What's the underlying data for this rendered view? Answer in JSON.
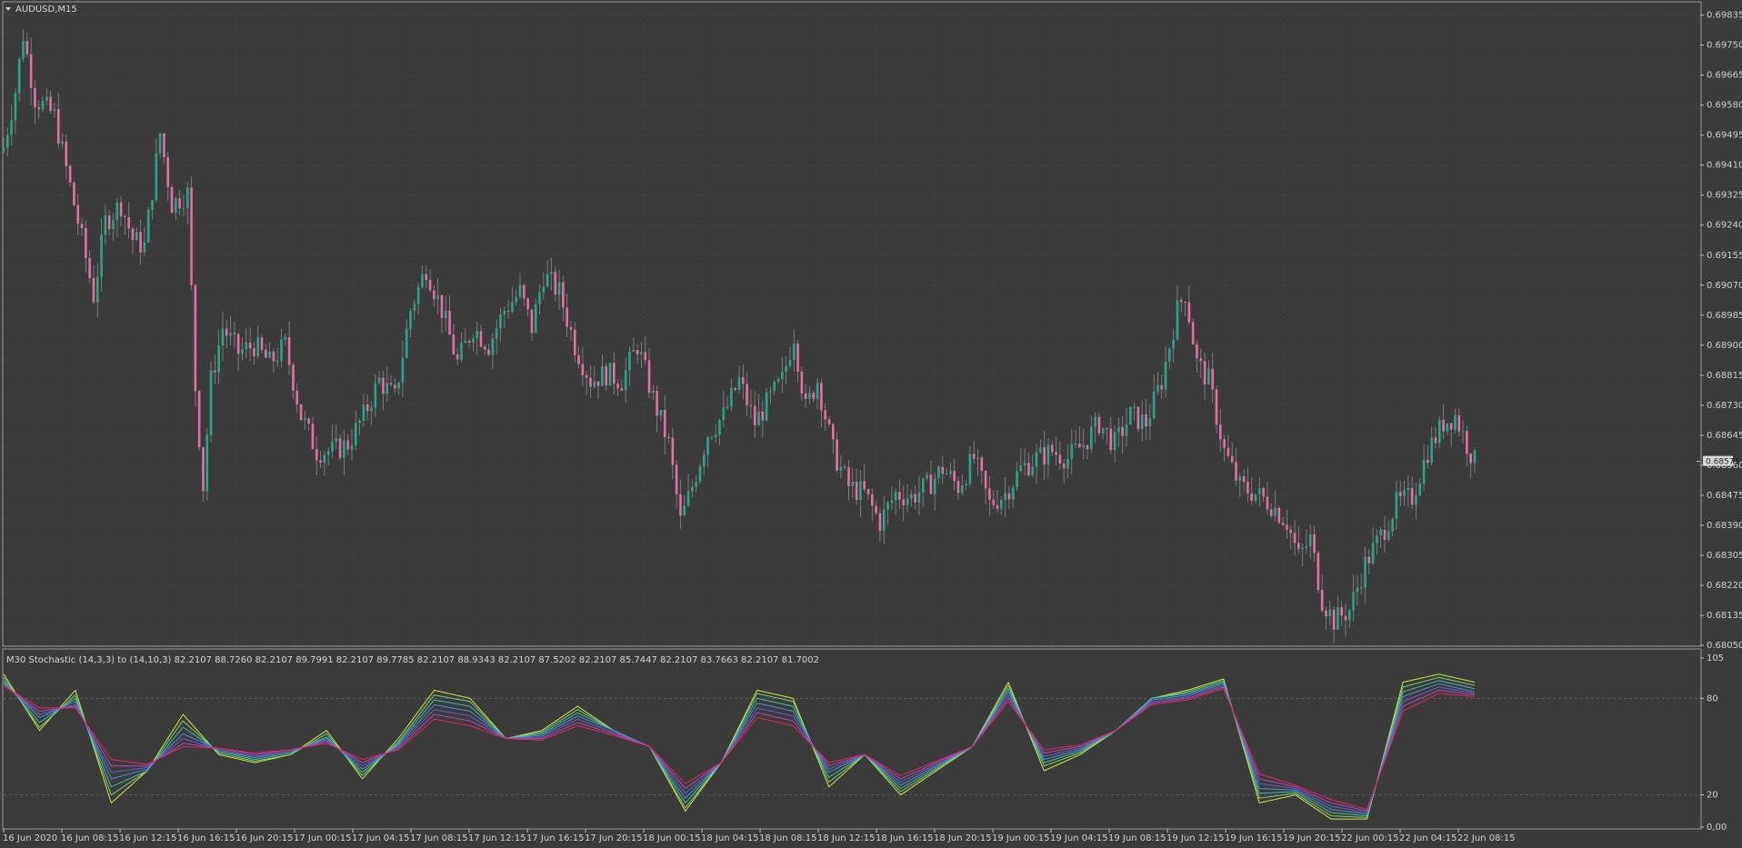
{
  "window": {
    "symbol_label": "AUDUSD,M15",
    "menu_icon": "triangle-down-icon"
  },
  "colors": {
    "background": "#3b3b3b",
    "grid": "#4a4a4a",
    "border": "#9a9a9a",
    "bull": "#26a98a",
    "bear": "#e86fa4",
    "text": "#d0d0d0"
  },
  "chart_data": [
    {
      "type": "candlestick",
      "title": "AUDUSD,M15",
      "ylim": [
        0.6805,
        0.6987
      ],
      "y_ticks": [
        "0.69835",
        "0.69750",
        "0.69665",
        "0.69580",
        "0.69495",
        "0.69410",
        "0.69325",
        "0.69240",
        "0.69155",
        "0.69070",
        "0.68985",
        "0.68900",
        "0.68815",
        "0.68730",
        "0.68645",
        "0.68560",
        "0.68475",
        "0.68390",
        "0.68305",
        "0.68220",
        "0.68135",
        "0.68050"
      ],
      "current_price_label": "0.68571",
      "current_price": 0.68571,
      "close_points": [
        {
          "t": 0,
          "v": 0.6946
        },
        {
          "t": 3,
          "v": 0.6962
        },
        {
          "t": 5,
          "v": 0.6978
        },
        {
          "t": 8,
          "v": 0.696
        },
        {
          "t": 13,
          "v": 0.6955
        },
        {
          "t": 17,
          "v": 0.6935
        },
        {
          "t": 20,
          "v": 0.692
        },
        {
          "t": 23,
          "v": 0.6904
        },
        {
          "t": 26,
          "v": 0.6925
        },
        {
          "t": 30,
          "v": 0.693
        },
        {
          "t": 33,
          "v": 0.692
        },
        {
          "t": 36,
          "v": 0.6918
        },
        {
          "t": 40,
          "v": 0.695
        },
        {
          "t": 43,
          "v": 0.693
        },
        {
          "t": 47,
          "v": 0.6933
        },
        {
          "t": 49,
          "v": 0.6878
        },
        {
          "t": 51,
          "v": 0.685
        },
        {
          "t": 53,
          "v": 0.688
        },
        {
          "t": 56,
          "v": 0.6895
        },
        {
          "t": 60,
          "v": 0.6888
        },
        {
          "t": 64,
          "v": 0.689
        },
        {
          "t": 68,
          "v": 0.6885
        },
        {
          "t": 72,
          "v": 0.689
        },
        {
          "t": 76,
          "v": 0.687
        },
        {
          "t": 80,
          "v": 0.686
        },
        {
          "t": 84,
          "v": 0.686
        },
        {
          "t": 88,
          "v": 0.6862
        },
        {
          "t": 92,
          "v": 0.687
        },
        {
          "t": 96,
          "v": 0.688
        },
        {
          "t": 100,
          "v": 0.6875
        },
        {
          "t": 104,
          "v": 0.69
        },
        {
          "t": 108,
          "v": 0.6912
        },
        {
          "t": 112,
          "v": 0.69
        },
        {
          "t": 116,
          "v": 0.6885
        },
        {
          "t": 120,
          "v": 0.6895
        },
        {
          "t": 124,
          "v": 0.689
        },
        {
          "t": 128,
          "v": 0.69
        },
        {
          "t": 132,
          "v": 0.6905
        },
        {
          "t": 135,
          "v": 0.6895
        },
        {
          "t": 138,
          "v": 0.691
        },
        {
          "t": 142,
          "v": 0.6905
        },
        {
          "t": 146,
          "v": 0.689
        },
        {
          "t": 150,
          "v": 0.688
        },
        {
          "t": 154,
          "v": 0.6882
        },
        {
          "t": 158,
          "v": 0.688
        },
        {
          "t": 162,
          "v": 0.689
        },
        {
          "t": 166,
          "v": 0.6875
        },
        {
          "t": 170,
          "v": 0.6862
        },
        {
          "t": 173,
          "v": 0.684
        },
        {
          "t": 176,
          "v": 0.685
        },
        {
          "t": 180,
          "v": 0.6865
        },
        {
          "t": 184,
          "v": 0.687
        },
        {
          "t": 188,
          "v": 0.688
        },
        {
          "t": 192,
          "v": 0.6868
        },
        {
          "t": 196,
          "v": 0.6875
        },
        {
          "t": 199,
          "v": 0.688
        },
        {
          "t": 202,
          "v": 0.6893
        },
        {
          "t": 205,
          "v": 0.6872
        },
        {
          "t": 208,
          "v": 0.688
        },
        {
          "t": 212,
          "v": 0.686
        },
        {
          "t": 216,
          "v": 0.685
        },
        {
          "t": 220,
          "v": 0.6848
        },
        {
          "t": 224,
          "v": 0.684
        },
        {
          "t": 228,
          "v": 0.6848
        },
        {
          "t": 232,
          "v": 0.6847
        },
        {
          "t": 236,
          "v": 0.685
        },
        {
          "t": 240,
          "v": 0.6855
        },
        {
          "t": 244,
          "v": 0.685
        },
        {
          "t": 248,
          "v": 0.6858
        },
        {
          "t": 252,
          "v": 0.6845
        },
        {
          "t": 256,
          "v": 0.6848
        },
        {
          "t": 260,
          "v": 0.6855
        },
        {
          "t": 264,
          "v": 0.6858
        },
        {
          "t": 268,
          "v": 0.686
        },
        {
          "t": 272,
          "v": 0.6858
        },
        {
          "t": 276,
          "v": 0.6862
        },
        {
          "t": 280,
          "v": 0.6868
        },
        {
          "t": 284,
          "v": 0.6862
        },
        {
          "t": 288,
          "v": 0.687
        },
        {
          "t": 292,
          "v": 0.6868
        },
        {
          "t": 296,
          "v": 0.688
        },
        {
          "t": 300,
          "v": 0.69
        },
        {
          "t": 302,
          "v": 0.6905
        },
        {
          "t": 305,
          "v": 0.6885
        },
        {
          "t": 308,
          "v": 0.688
        },
        {
          "t": 312,
          "v": 0.686
        },
        {
          "t": 316,
          "v": 0.685
        },
        {
          "t": 320,
          "v": 0.6848
        },
        {
          "t": 324,
          "v": 0.6845
        },
        {
          "t": 328,
          "v": 0.684
        },
        {
          "t": 331,
          "v": 0.683
        },
        {
          "t": 334,
          "v": 0.6835
        },
        {
          "t": 337,
          "v": 0.6818
        },
        {
          "t": 340,
          "v": 0.6812
        },
        {
          "t": 344,
          "v": 0.6815
        },
        {
          "t": 348,
          "v": 0.6828
        },
        {
          "t": 352,
          "v": 0.6836
        },
        {
          "t": 356,
          "v": 0.6845
        },
        {
          "t": 360,
          "v": 0.6847
        },
        {
          "t": 364,
          "v": 0.686
        },
        {
          "t": 368,
          "v": 0.6868
        },
        {
          "t": 371,
          "v": 0.687
        },
        {
          "t": 374,
          "v": 0.6862
        },
        {
          "t": 376,
          "v": 0.6857
        }
      ],
      "start_price": 0.6945
    },
    {
      "type": "line",
      "title": "M30 Stochastic (14,3,3) to (14,10,3) 82.2107 88.7260 82.2107 89.7991 82.2107 89.7785 82.2107 88.9343 82.2107 87.5202 82.2107 85.7447 82.2107 83.7663 82.2107 81.7002",
      "ylim": [
        0,
        105
      ],
      "y_ticks": [
        "105",
        "80",
        "20",
        "0,00"
      ],
      "levels": [
        80,
        20
      ],
      "x_tick_labels": [
        "16 Jun 2020",
        "16 Jun 08:15",
        "16 Jun 12:15",
        "16 Jun 16:15",
        "16 Jun 20:15",
        "17 Jun 00:15",
        "17 Jun 04:15",
        "17 Jun 08:15",
        "17 Jun 12:15",
        "17 Jun 16:15",
        "17 Jun 20:15",
        "18 Jun 00:15",
        "18 Jun 04:15",
        "18 Jun 08:15",
        "18 Jun 12:15",
        "18 Jun 16:15",
        "18 Jun 20:15",
        "19 Jun 00:15",
        "19 Jun 04:15",
        "19 Jun 08:15",
        "19 Jun 12:15",
        "19 Jun 16:15",
        "19 Jun 20:15",
        "22 Jun 00:15",
        "22 Jun 04:15",
        "22 Jun 08:15"
      ],
      "x": [
        0,
        10,
        20,
        30,
        40,
        50,
        60,
        70,
        80,
        90,
        100,
        110,
        120,
        130,
        140,
        150,
        160,
        170,
        180,
        190,
        200,
        210,
        220,
        230,
        240,
        250,
        260,
        270,
        280,
        290,
        300,
        310,
        320,
        330,
        340,
        350,
        360,
        370,
        376
      ],
      "series": [
        {
          "color": "#c8e84a",
          "values": [
            95,
            60,
            85,
            15,
            35,
            70,
            45,
            40,
            45,
            60,
            30,
            55,
            85,
            80,
            55,
            60,
            75,
            60,
            50,
            10,
            40,
            85,
            80,
            25,
            45,
            20,
            35,
            50,
            90,
            35,
            45,
            60,
            80,
            85,
            92,
            15,
            20,
            5,
            5,
            90,
            95,
            90
          ]
        },
        {
          "color": "#7fd06a",
          "values": [
            93,
            62,
            82,
            20,
            35,
            66,
            46,
            41,
            45,
            58,
            32,
            53,
            82,
            78,
            55,
            59,
            73,
            60,
            50,
            12,
            40,
            83,
            78,
            28,
            45,
            22,
            36,
            50,
            88,
            38,
            46,
            60,
            80,
            84,
            91,
            18,
            21,
            7,
            6,
            87,
            93,
            88
          ]
        },
        {
          "color": "#3fbfa8",
          "values": [
            91,
            65,
            80,
            25,
            35,
            62,
            47,
            42,
            46,
            56,
            34,
            52,
            79,
            75,
            55,
            58,
            71,
            60,
            50,
            15,
            40,
            80,
            75,
            31,
            45,
            24,
            37,
            50,
            86,
            40,
            47,
            60,
            80,
            83,
            90,
            21,
            22,
            9,
            7,
            84,
            91,
            86
          ]
        },
        {
          "color": "#4a8fd8",
          "values": [
            90,
            68,
            78,
            30,
            36,
            58,
            48,
            43,
            47,
            55,
            36,
            51,
            76,
            72,
            55,
            57,
            69,
            60,
            50,
            18,
            40,
            77,
            72,
            34,
            45,
            26,
            38,
            50,
            84,
            42,
            48,
            60,
            79,
            82,
            89,
            24,
            23,
            11,
            8,
            81,
            89,
            84
          ]
        },
        {
          "color": "#6a5cd0",
          "values": [
            89,
            70,
            76,
            34,
            37,
            55,
            48,
            44,
            47,
            54,
            38,
            50,
            73,
            69,
            55,
            56,
            67,
            59,
            50,
            21,
            40,
            74,
            69,
            36,
            45,
            28,
            39,
            50,
            82,
            44,
            49,
            60,
            78,
            81,
            88,
            27,
            24,
            13,
            9,
            78,
            87,
            83
          ]
        },
        {
          "color": "#b04ab8",
          "values": [
            88,
            72,
            75,
            38,
            38,
            52,
            49,
            45,
            48,
            53,
            40,
            49,
            70,
            66,
            55,
            55,
            65,
            58,
            50,
            24,
            40,
            71,
            66,
            38,
            45,
            30,
            40,
            50,
            80,
            46,
            50,
            60,
            77,
            80,
            87,
            30,
            25,
            15,
            10,
            75,
            85,
            82
          ]
        },
        {
          "color": "#e02860",
          "values": [
            88,
            74,
            74,
            42,
            39,
            50,
            49,
            46,
            48,
            52,
            42,
            48,
            67,
            63,
            55,
            54,
            63,
            57,
            50,
            27,
            40,
            68,
            63,
            40,
            45,
            32,
            41,
            50,
            78,
            48,
            51,
            60,
            76,
            79,
            86,
            33,
            26,
            17,
            11,
            72,
            83,
            81
          ]
        }
      ]
    }
  ]
}
